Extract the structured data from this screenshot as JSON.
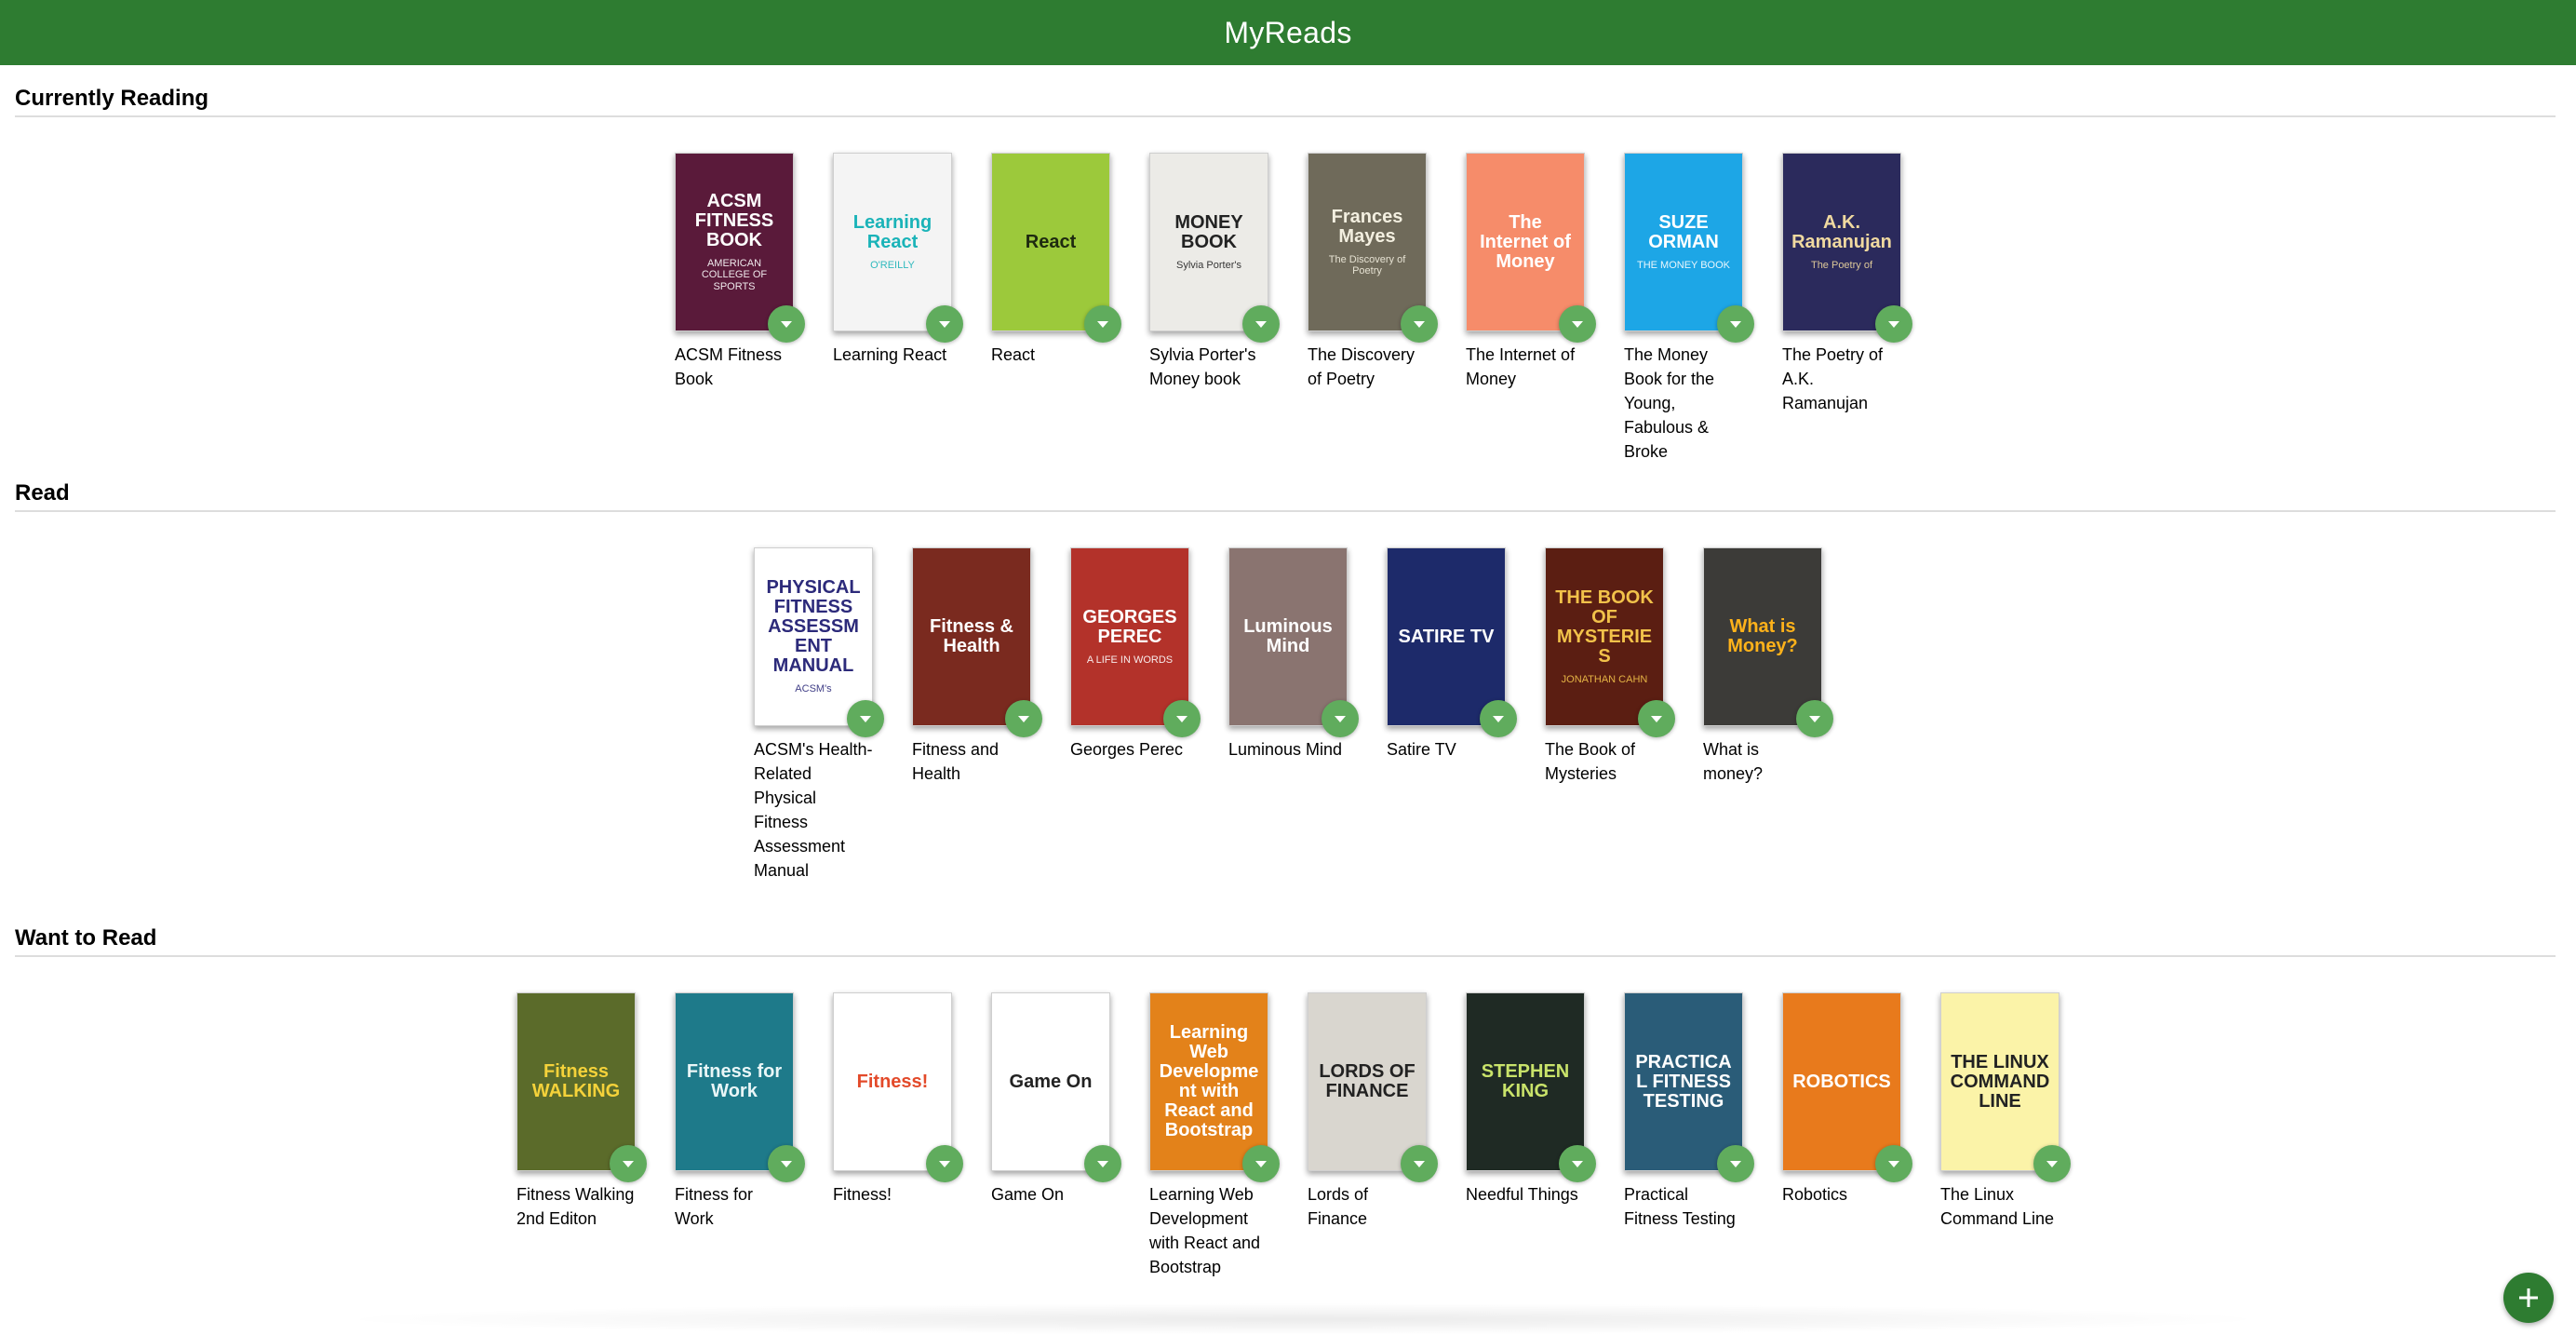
{
  "app": {
    "title": "MyReads"
  },
  "shelves": [
    {
      "title": "Currently Reading",
      "books": [
        {
          "title": "ACSM Fitness Book",
          "cover_text": "ACSM FITNESS BOOK",
          "cover_sub": "AMERICAN COLLEGE OF SPORTS",
          "bg": "#5a1a3a",
          "fg": "#ffffff"
        },
        {
          "title": "Learning React",
          "cover_text": "Learning React",
          "cover_sub": "O'REILLY",
          "bg": "#f4f4f4",
          "fg": "#1ab3b8"
        },
        {
          "title": "React",
          "cover_text": "React",
          "cover_sub": "",
          "bg": "#9cc93b",
          "fg": "#1e2a10"
        },
        {
          "title": "Sylvia Porter's Money book",
          "cover_text": "MONEY BOOK",
          "cover_sub": "Sylvia Porter's",
          "bg": "#ecebe7",
          "fg": "#222222"
        },
        {
          "title": "The Discovery of Poetry",
          "cover_text": "Frances Mayes",
          "cover_sub": "The Discovery of Poetry",
          "bg": "#6f6a5a",
          "fg": "#f3efe0"
        },
        {
          "title": "The Internet of Money",
          "cover_text": "The Internet of Money",
          "cover_sub": "",
          "bg": "#f68c6a",
          "fg": "#ffffff"
        },
        {
          "title": "The Money Book for the Young, Fabulous & Broke",
          "cover_text": "SUZE ORMAN",
          "cover_sub": "THE MONEY BOOK",
          "bg": "#1da6e6",
          "fg": "#ffffff"
        },
        {
          "title": "The Poetry of A.K. Ramanujan",
          "cover_text": "A.K. Ramanujan",
          "cover_sub": "The Poetry of",
          "bg": "#2b2a5c",
          "fg": "#f0d9a0"
        }
      ]
    },
    {
      "title": "Read",
      "books": [
        {
          "title": "ACSM's Health-Related Physical Fitness Assessment Manual",
          "cover_text": "PHYSICAL FITNESS ASSESSMENT MANUAL",
          "cover_sub": "ACSM's",
          "bg": "#ffffff",
          "fg": "#2c2a7a"
        },
        {
          "title": "Fitness and Health",
          "cover_text": "Fitness & Health",
          "cover_sub": "",
          "bg": "#7a2a1f",
          "fg": "#ffffff"
        },
        {
          "title": "Georges Perec",
          "cover_text": "GEORGES PEREC",
          "cover_sub": "A LIFE IN WORDS",
          "bg": "#b3322a",
          "fg": "#ffffff"
        },
        {
          "title": "Luminous Mind",
          "cover_text": "Luminous Mind",
          "cover_sub": "",
          "bg": "#8a7470",
          "fg": "#ffffff"
        },
        {
          "title": "Satire TV",
          "cover_text": "SATIRE TV",
          "cover_sub": "",
          "bg": "#1d2a6a",
          "fg": "#ffffff"
        },
        {
          "title": "The Book of Mysteries",
          "cover_text": "THE BOOK OF MYSTERIES",
          "cover_sub": "JONATHAN CAHN",
          "bg": "#5b1e12",
          "fg": "#f2c24a"
        },
        {
          "title": "What is money?",
          "cover_text": "What is Money?",
          "cover_sub": "",
          "bg": "#3c3b38",
          "fg": "#ffb21a"
        }
      ]
    },
    {
      "title": "Want to Read",
      "books": [
        {
          "title": "Fitness Walking 2nd Editon",
          "cover_text": "Fitness WALKING",
          "cover_sub": "",
          "bg": "#5b6b2a",
          "fg": "#f5d23a"
        },
        {
          "title": "Fitness for Work",
          "cover_text": "Fitness for Work",
          "cover_sub": "",
          "bg": "#1e7a8a",
          "fg": "#e9f6f7"
        },
        {
          "title": "Fitness!",
          "cover_text": "Fitness!",
          "cover_sub": "",
          "bg": "#ffffff",
          "fg": "#e34a2a"
        },
        {
          "title": "Game On",
          "cover_text": "Game On",
          "cover_sub": "",
          "bg": "#ffffff",
          "fg": "#222222"
        },
        {
          "title": "Learning Web Development with React and Bootstrap",
          "cover_text": "Learning Web Development with React and Bootstrap",
          "cover_sub": "",
          "bg": "#e3821a",
          "fg": "#ffffff"
        },
        {
          "title": "Lords of Finance",
          "cover_text": "LORDS OF FINANCE",
          "cover_sub": "",
          "bg": "#d9d6cf",
          "fg": "#222222"
        },
        {
          "title": "Needful Things",
          "cover_text": "STEPHEN KING",
          "cover_sub": "",
          "bg": "#1f2a24",
          "fg": "#c9e36a"
        },
        {
          "title": "Practical Fitness Testing",
          "cover_text": "PRACTICAL FITNESS TESTING",
          "cover_sub": "",
          "bg": "#2a5c78",
          "fg": "#ffffff"
        },
        {
          "title": "Robotics",
          "cover_text": "ROBOTICS",
          "cover_sub": "",
          "bg": "#e87a1c",
          "fg": "#ffffff"
        },
        {
          "title": "The Linux Command Line",
          "cover_text": "THE LINUX COMMAND LINE",
          "cover_sub": "",
          "bg": "#fbf3a8",
          "fg": "#222222"
        }
      ]
    }
  ],
  "colors": {
    "header": "#2e7c31",
    "changer": "#60ac5d"
  },
  "icons": {
    "shelf_changer": "chevron-down-icon",
    "add": "plus-icon"
  }
}
